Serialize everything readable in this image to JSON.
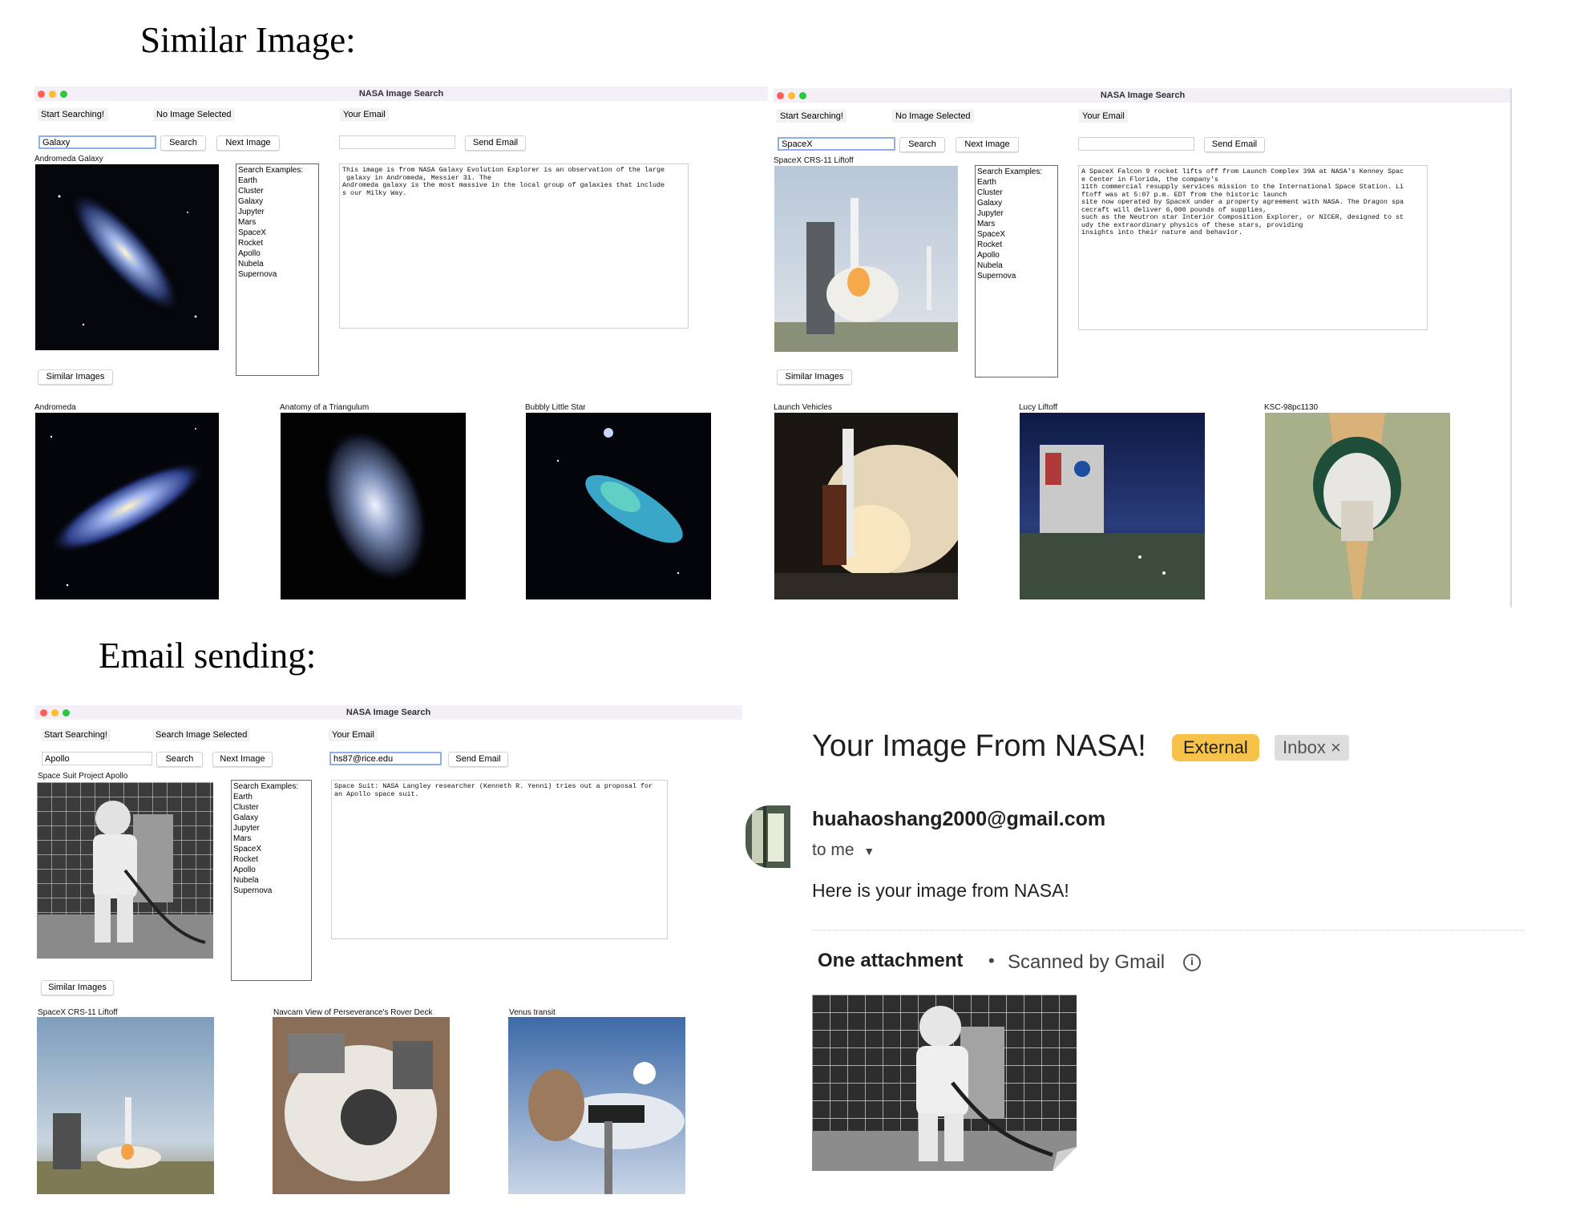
{
  "headings": {
    "similar": "Similar Image:",
    "email": "Email sending:"
  },
  "app": {
    "title": "NASA Image Search",
    "start_label": "Start Searching!",
    "email_label": "Your Email",
    "search_button": "Search",
    "next_button": "Next Image",
    "send_button": "Send Email",
    "similar_button": "Similar Images",
    "examples": [
      "Search Examples:",
      "Earth",
      "Cluster",
      "Galaxy",
      "Jupyter",
      "Mars",
      "SpaceX",
      "Rocket",
      "Apollo",
      "Nubela",
      "Supernova"
    ]
  },
  "windows": [
    {
      "status": "No Image Selected",
      "query": "Galaxy",
      "email": "",
      "main_caption": "Andromeda Galaxy",
      "description": "This image is from NASA Galaxy Evolution Explorer is an observation of the large\n galaxy in Andromeda, Messier 31. The\nAndromeda galaxy is the most massive in the local group of galaxies that include\ns our Milky Way.",
      "similar": [
        "Andromeda",
        "Anatomy of a Triangulum",
        "Bubbly Little Star"
      ]
    },
    {
      "status": "No Image Selected",
      "query": "SpaceX",
      "email": "",
      "main_caption": "SpaceX CRS-11 Liftoff",
      "description": "A SpaceX Falcon 9 rocket lifts off from Launch Complex 39A at NASA's Kenney Spac\ne Center in Florida, the company's\n11th commercial resupply services mission to the International Space Station. Li\nftoff was at 5:07 p.m. EDT from the historic launch\nsite now operated by SpaceX under a property agreement with NASA. The Dragon spa\ncecraft will deliver 6,000 pounds of supplies,\nsuch as the Neutron star Interior Composition Explorer, or NICER, designed to st\nudy the extraordinary physics of these stars, providing\ninsights into their nature and behavior.",
      "similar": [
        "Launch Vehicles",
        "Lucy Liftoff",
        "KSC-98pc1130"
      ]
    },
    {
      "status": "Search Image Selected",
      "query": "Apollo",
      "email": "hs87@rice.edu",
      "main_caption": "Space Suit Project Apollo",
      "description": "Space Suit: NASA Langley researcher (Kenneth R. Yenni) tries out a proposal for\nan Apollo space suit.",
      "similar": [
        "SpaceX CRS-11 Liftoff",
        "Navcam View of Perseverance's Rover Deck",
        "Venus transit"
      ]
    }
  ],
  "gmail": {
    "subject": "Your Image From NASA!",
    "badge_external": "External",
    "badge_inbox": "Inbox",
    "badge_close": "×",
    "from": "huahaoshang2000@gmail.com",
    "to": "to me",
    "to_icon": "caret-down-icon",
    "body": "Here is your image from NASA!",
    "attachment_count": "One attachment",
    "separator": "•",
    "scanned": "Scanned by Gmail",
    "info_icon": "info-icon",
    "colors": {
      "external": "#f6c24a",
      "inbox": "#dddddd"
    }
  }
}
